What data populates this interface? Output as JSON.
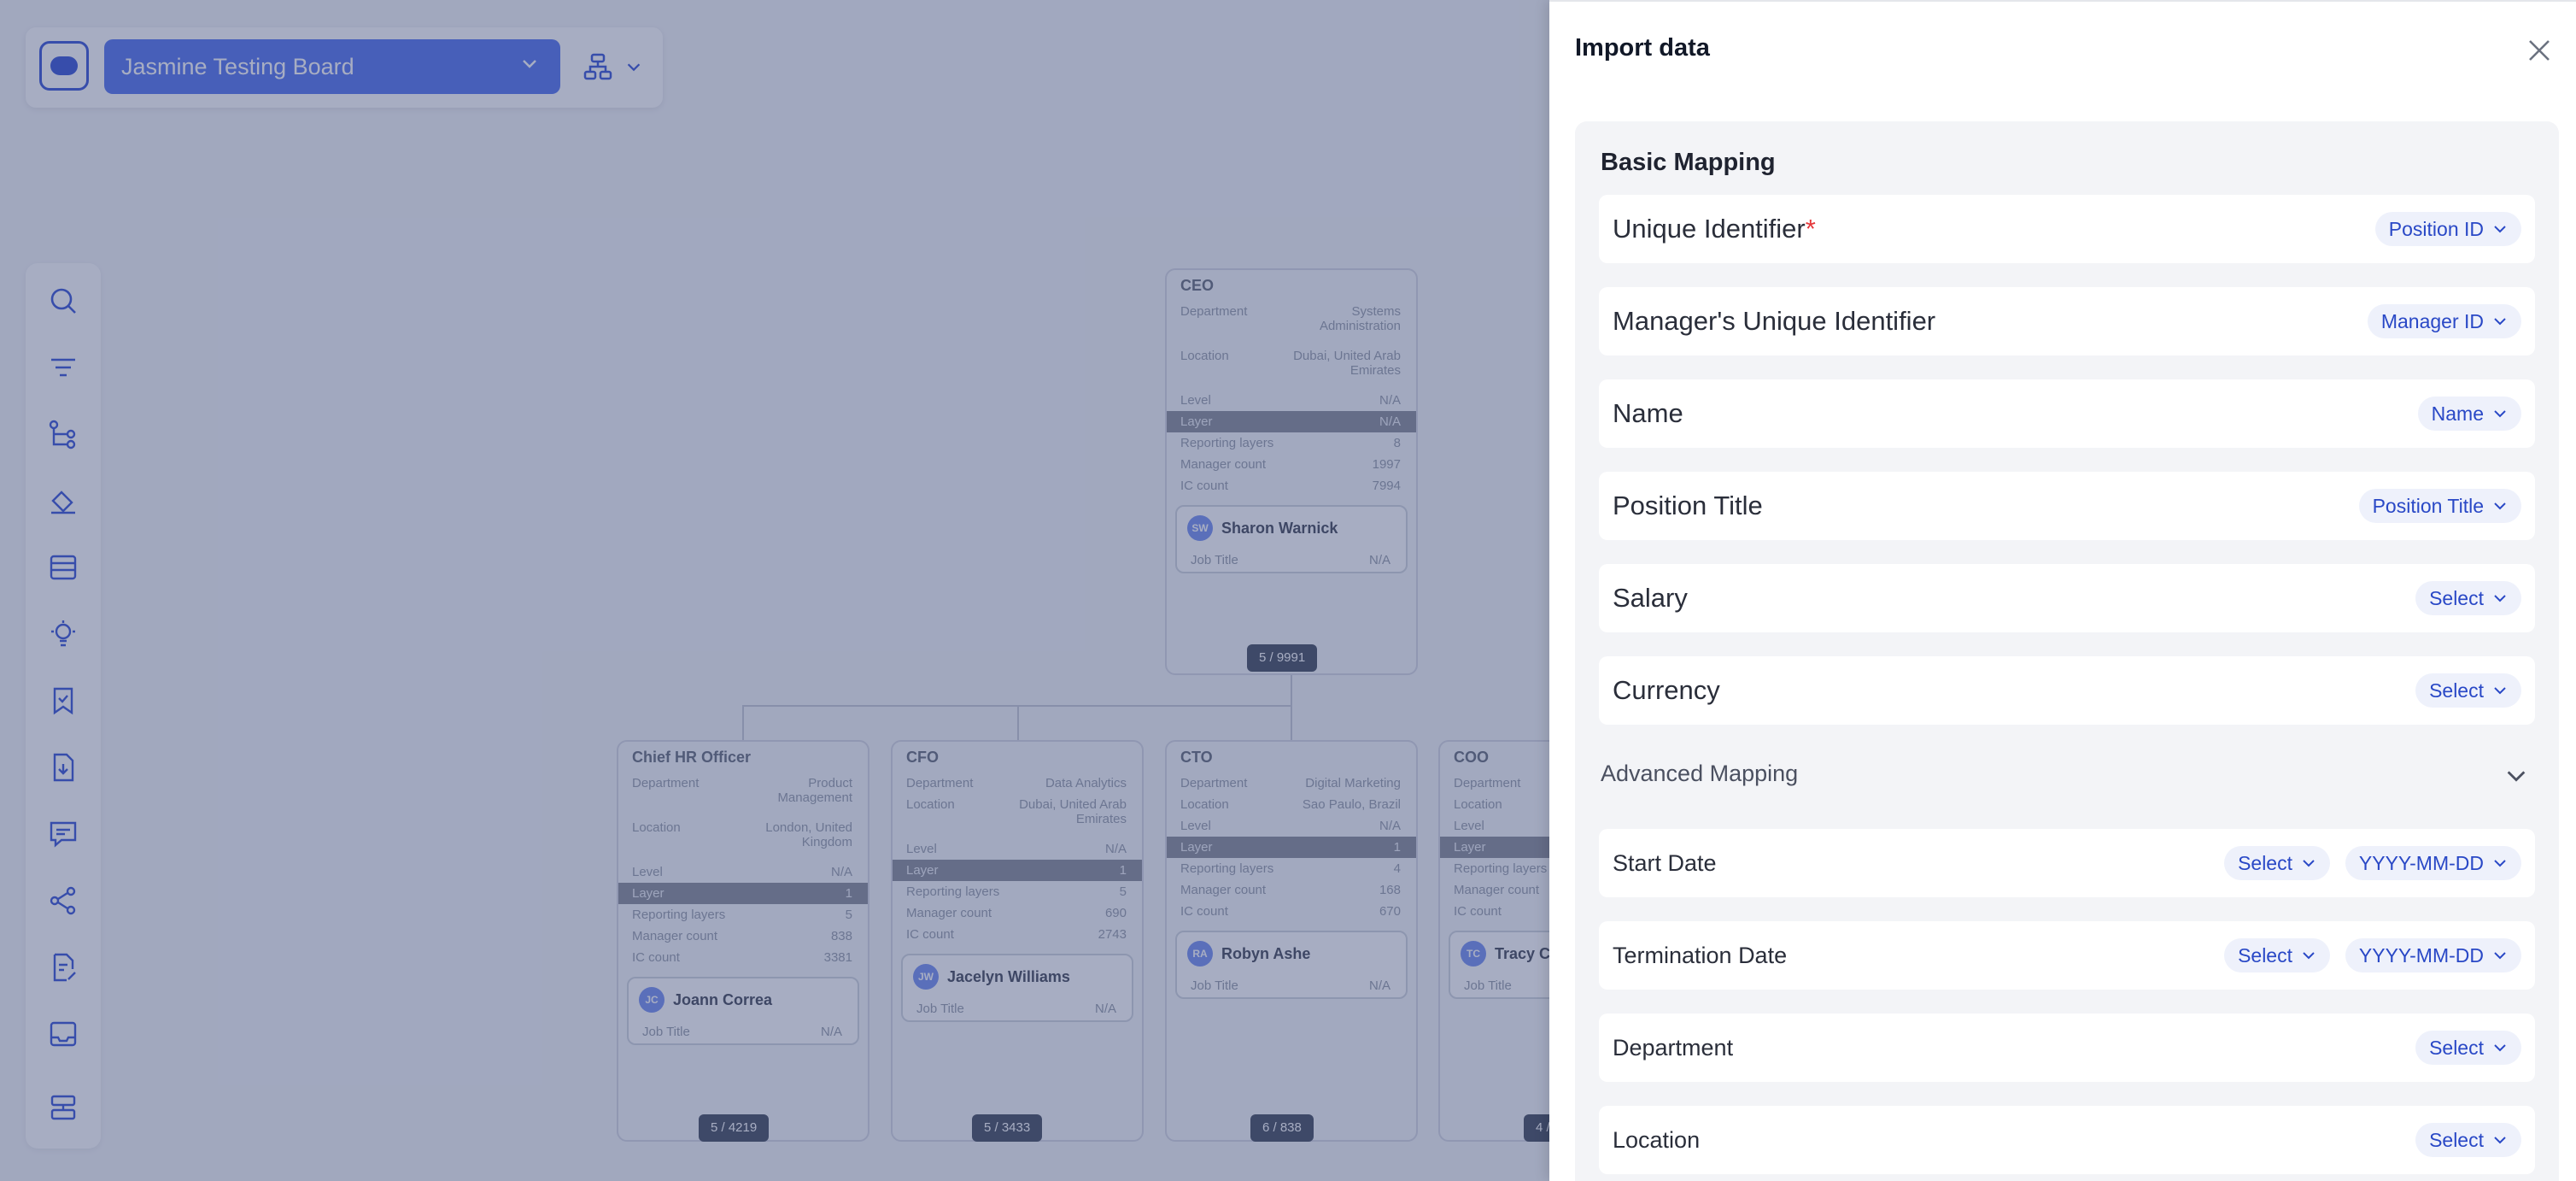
{
  "background": {
    "board_name": "Jasmine Testing Board",
    "cards": {
      "ceo": {
        "title": "CEO",
        "rows": [
          {
            "label": "Department",
            "value": "Systems Administration"
          },
          {
            "label": "Location",
            "value": "Dubai, United Arab Emirates"
          },
          {
            "label": "Level",
            "value": "N/A"
          },
          {
            "label": "Layer",
            "value": "N/A"
          },
          {
            "label": "Reporting layers",
            "value": "8"
          },
          {
            "label": "Manager count",
            "value": "1997"
          },
          {
            "label": "IC count",
            "value": "7994"
          }
        ],
        "initials": "SW",
        "name": "Sharon Warnick",
        "job_label": "Job Title",
        "job_value": "N/A",
        "count": "5 / 9991"
      },
      "chro": {
        "title": "Chief HR Officer",
        "rows": [
          {
            "label": "Department",
            "value": "Product Management"
          },
          {
            "label": "Location",
            "value": "London, United Kingdom"
          },
          {
            "label": "Level",
            "value": "N/A"
          },
          {
            "label": "Layer",
            "value": "1"
          },
          {
            "label": "Reporting layers",
            "value": "5"
          },
          {
            "label": "Manager count",
            "value": "838"
          },
          {
            "label": "IC count",
            "value": "3381"
          }
        ],
        "initials": "JC",
        "name": "Joann Correa",
        "job_label": "Job Title",
        "job_value": "N/A",
        "count": "5 / 4219"
      },
      "cfo": {
        "title": "CFO",
        "rows": [
          {
            "label": "Department",
            "value": "Data Analytics"
          },
          {
            "label": "Location",
            "value": "Dubai, United Arab Emirates"
          },
          {
            "label": "Level",
            "value": "N/A"
          },
          {
            "label": "Layer",
            "value": "1"
          },
          {
            "label": "Reporting layers",
            "value": "5"
          },
          {
            "label": "Manager count",
            "value": "690"
          },
          {
            "label": "IC count",
            "value": "2743"
          }
        ],
        "initials": "JW",
        "name": "Jacelyn Williams",
        "job_label": "Job Title",
        "job_value": "N/A",
        "count": "5 / 3433"
      },
      "cto": {
        "title": "CTO",
        "rows": [
          {
            "label": "Department",
            "value": "Digital Marketing"
          },
          {
            "label": "Location",
            "value": "Sao Paulo, Brazil"
          },
          {
            "label": "Level",
            "value": "N/A"
          },
          {
            "label": "Layer",
            "value": "1"
          },
          {
            "label": "Reporting layers",
            "value": "4"
          },
          {
            "label": "Manager count",
            "value": "168"
          },
          {
            "label": "IC count",
            "value": "670"
          }
        ],
        "initials": "RA",
        "name": "Robyn Ashe",
        "job_label": "Job Title",
        "job_value": "N/A",
        "count": "6 / 838"
      },
      "coo": {
        "title": "COO",
        "rows": [
          {
            "label": "Department",
            "value": ""
          },
          {
            "label": "Location",
            "value": ""
          },
          {
            "label": "Level",
            "value": ""
          },
          {
            "label": "Layer",
            "value": ""
          },
          {
            "label": "Reporting layers",
            "value": ""
          },
          {
            "label": "Manager count",
            "value": ""
          },
          {
            "label": "IC count",
            "value": ""
          }
        ],
        "initials": "TC",
        "name": "Tracy C",
        "job_label": "Job Title",
        "job_value": "",
        "count": "4 /"
      }
    }
  },
  "panel": {
    "title": "Import data",
    "basic_title": "Basic Mapping",
    "advanced_title": "Advanced Mapping",
    "rows": [
      {
        "label": "Unique Identifier",
        "required_mark": "*",
        "value": "Position ID"
      },
      {
        "label": "Manager's Unique Identifier",
        "value": "Manager ID"
      },
      {
        "label": "Name",
        "value": "Name"
      },
      {
        "label": "Position Title",
        "value": "Position Title"
      },
      {
        "label": "Salary",
        "value": "Select"
      },
      {
        "label": "Currency",
        "value": "Select"
      }
    ],
    "advanced_rows": [
      {
        "label": "Start Date",
        "value": "Select",
        "format": "YYYY-MM-DD"
      },
      {
        "label": "Termination Date",
        "value": "Select",
        "format": "YYYY-MM-DD"
      },
      {
        "label": "Department",
        "value": "Select"
      },
      {
        "label": "Location",
        "value": "Select"
      }
    ]
  },
  "colors": {
    "accent": "#2948c6",
    "pill_bg": "#eef1fb",
    "required": "#e5383b",
    "overlay": "#2d3c6e"
  }
}
